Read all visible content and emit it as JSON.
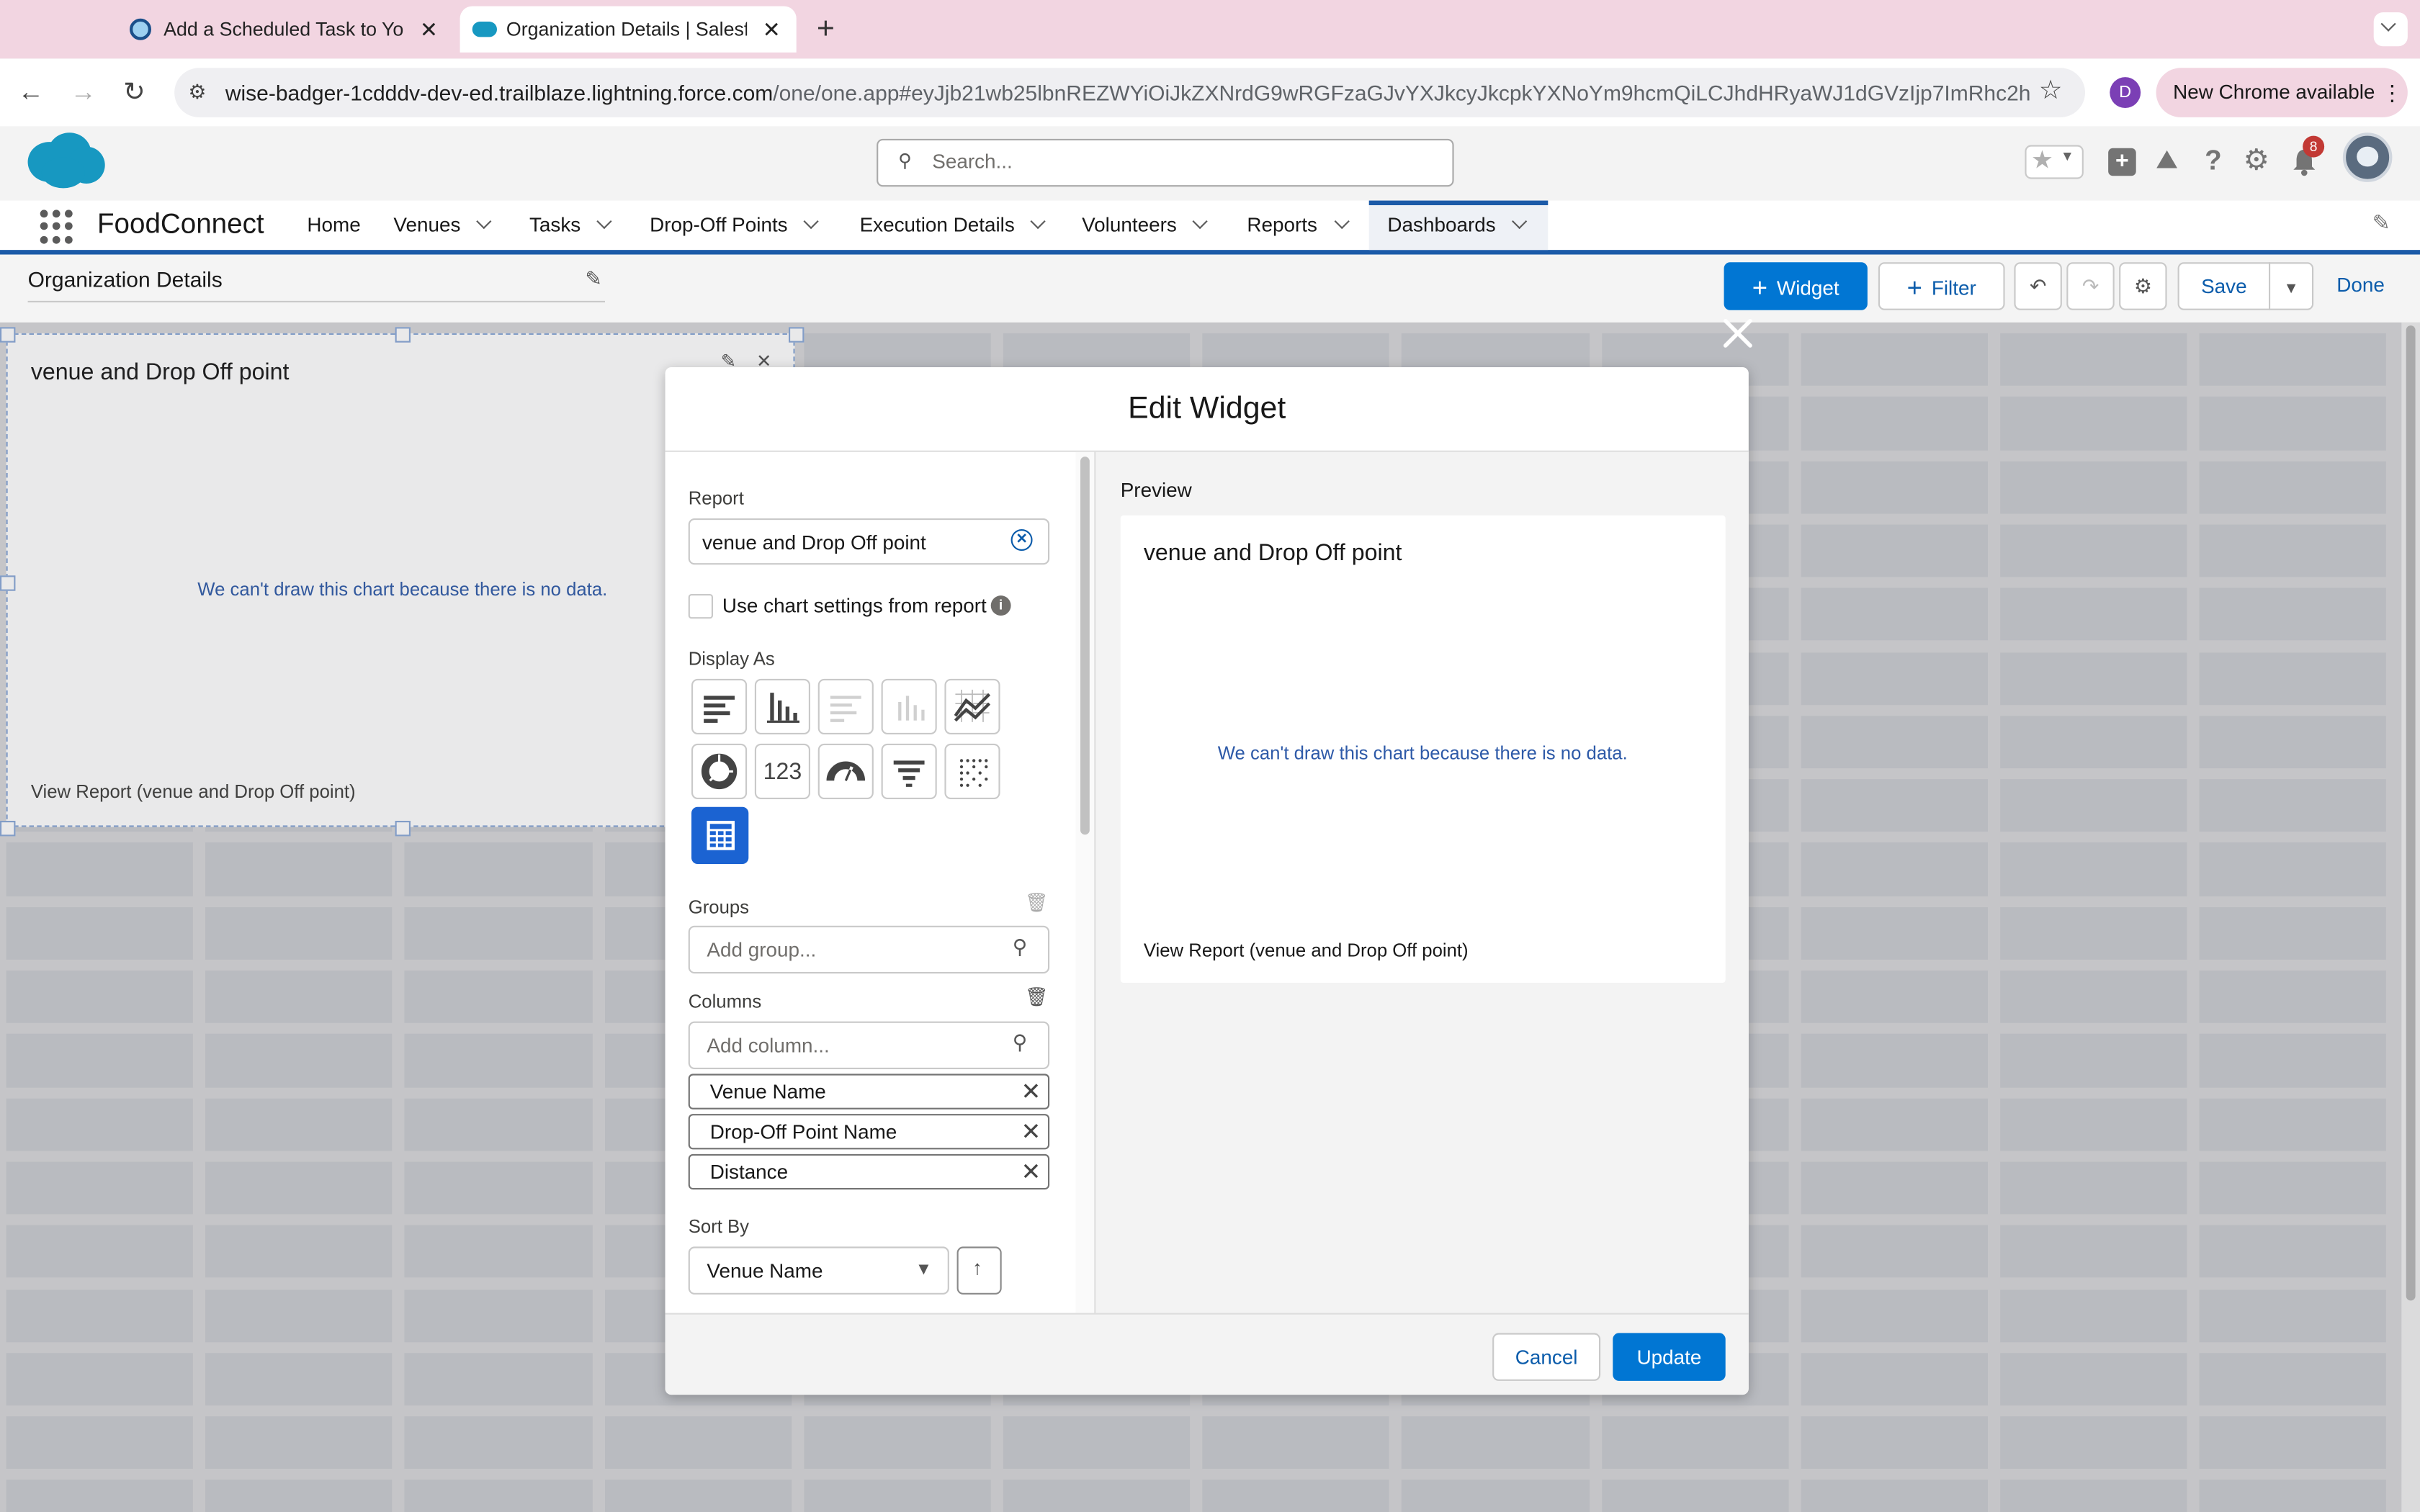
{
  "browser": {
    "tabs": [
      {
        "title": "Add a Scheduled Task to Your"
      },
      {
        "title": "Organization Details | Salesfo"
      }
    ],
    "url_domain": "wise-badger-1cdddv-dev-ed.trailblaze.lightning.force.com",
    "url_path": "/one/one.app#eyJjb21wb25lbnREZWYiOiJkZXNrdG9wRGFzaGJvYXJkcyJkcpkYXNoYm9hcmQiLCJhdHRyaWJ1dGVzIjp7ImRhc2hib2Fy...",
    "profile_initial": "D",
    "update_label": "New Chrome available"
  },
  "sf": {
    "search_placeholder": "Search...",
    "notification_count": "8",
    "app_name": "FoodConnect",
    "nav": [
      "Home",
      "Venues",
      "Tasks",
      "Drop-Off Points",
      "Execution Details",
      "Volunteers",
      "Reports",
      "Dashboards"
    ]
  },
  "builder": {
    "dashboard_name": "Organization Details",
    "widget_btn": "Widget",
    "filter_btn": "Filter",
    "save_btn": "Save",
    "done_btn": "Done"
  },
  "bg_widget": {
    "title": "venue and Drop Off point",
    "message": "We can't draw this chart because there is no data.",
    "link": "View Report (venue and Drop Off point)"
  },
  "modal": {
    "title": "Edit Widget",
    "report_label": "Report",
    "report_value": "venue and Drop Off point",
    "use_chart_settings": "Use chart settings from report",
    "display_as_label": "Display As",
    "metric_glyph": "123",
    "groups_label": "Groups",
    "groups_placeholder": "Add group...",
    "columns_label": "Columns",
    "columns_placeholder": "Add column...",
    "columns": [
      "Venue Name",
      "Drop-Off Point Name",
      "Distance"
    ],
    "sort_label": "Sort By",
    "sort_value": "Venue Name",
    "preview_label": "Preview",
    "preview_title": "venue and Drop Off point",
    "preview_message": "We can't draw this chart because there is no data.",
    "preview_link": "View Report (venue and Drop Off point)",
    "cancel": "Cancel",
    "update": "Update"
  },
  "colors": {
    "brand": "#0176d3",
    "selected": "#1b63d2",
    "tab_strip": "#f2d5e1"
  }
}
